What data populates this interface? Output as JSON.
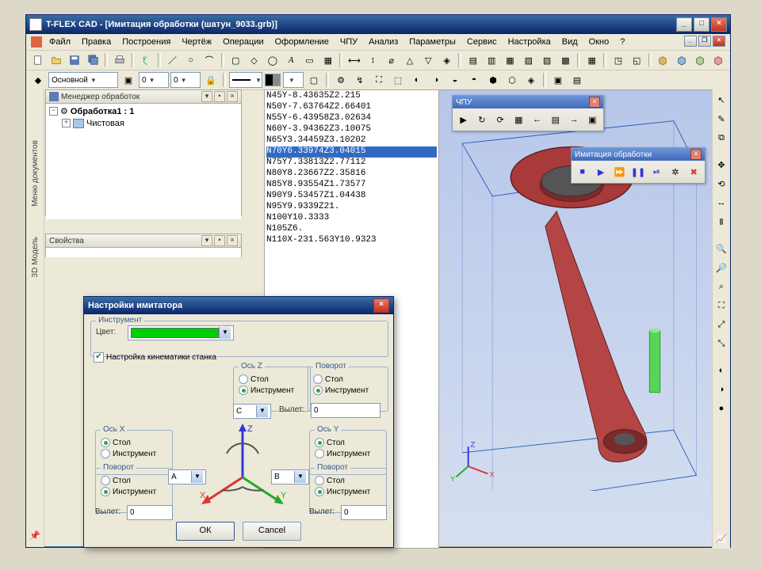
{
  "title": "T-FLEX CAD - [Имитация обработки (шатун_9033.grb)]",
  "menu": {
    "m0": "Файл",
    "m1": "Правка",
    "m2": "Построения",
    "m3": "Чертёж",
    "m4": "Операции",
    "m5": "Оформление",
    "m6": "ЧПУ",
    "m7": "Анализ",
    "m8": "Параметры",
    "m9": "Сервис",
    "m10": "Настройка",
    "m11": "Вид",
    "m12": "Окно",
    "m13": "?"
  },
  "toolbar2": {
    "combo1": "Основной",
    "inp1": "0",
    "inp2": "0"
  },
  "lefttabs": {
    "t1": "Меню документов",
    "t2": "3D Модель"
  },
  "mgr": {
    "title": "Менеджер обработок",
    "n1": "Обработка1 : 1",
    "n2": "Чистовая"
  },
  "props": {
    "title": "Свойства"
  },
  "nc": {
    "l0": "N45Y-8.43635Z2.215",
    "l1": "N50Y-7.63764Z2.66401",
    "l2": "N55Y-6.43958Z3.02634",
    "l3": "N60Y-3.94362Z3.10075",
    "l4": "N65Y3.34459Z3.10202",
    "l5": "N70Y6.33974Z3.04015",
    "l6": "N75Y7.33813Z2.77112",
    "l7": "N80Y8.23667Z2.35816",
    "l8": "N85Y8.93554Z1.73577",
    "l9": "N90Y9.53457Z1.04438",
    "l10": "N95Y9.9339Z21.",
    "l11": "N100Y10.3333",
    "l12": "N105Z6.",
    "l13": "N110X-231.563Y10.9323"
  },
  "float_cnc": {
    "title": "ЧПУ"
  },
  "float_sim": {
    "title": "Имитация обработки"
  },
  "dlg": {
    "title": "Настройки имитатора",
    "grp_instr": "Инструмент",
    "color_lbl": "Цвет:",
    "chk_kin": "Настройка кинематики станка",
    "axisX": "Ось X",
    "axisY": "Ось Y",
    "axisZ": "Ось Z",
    "rotation": "Поворот",
    "stol": "Стол",
    "instr": "Инструмент",
    "vylet": "Вылет:",
    "vylet_val": "0",
    "comboA": "A",
    "comboB": "B",
    "comboC": "C",
    "ok": "ОК",
    "cancel": "Cancel"
  }
}
